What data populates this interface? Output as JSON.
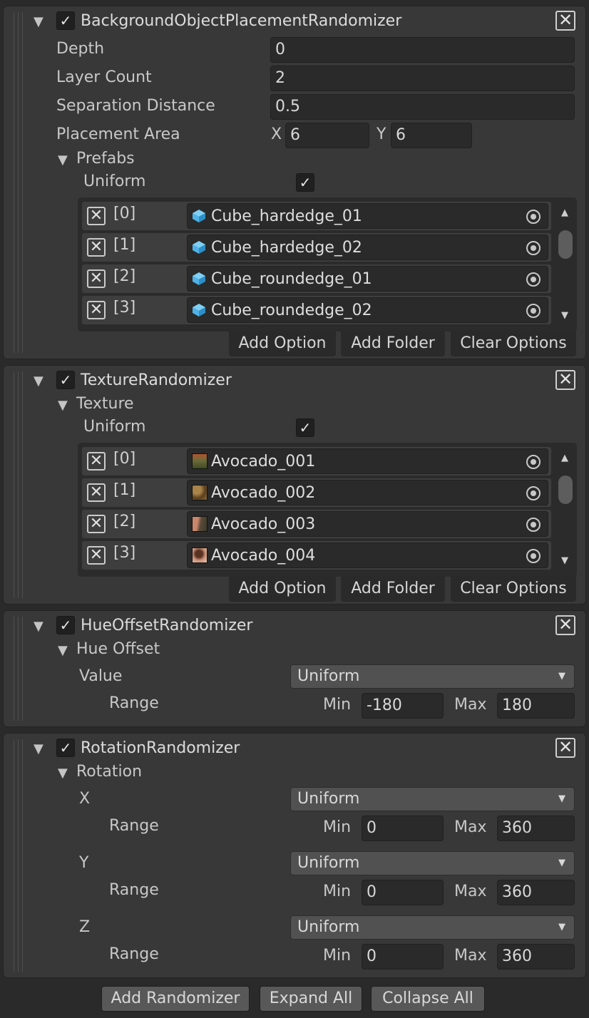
{
  "background_randomizer": {
    "title": "BackgroundObjectPlacementRandomizer",
    "enabled": "✓",
    "depth_label": "Depth",
    "depth_value": "0",
    "layer_count_label": "Layer Count",
    "layer_count_value": "2",
    "separation_label": "Separation Distance",
    "separation_value": "0.5",
    "placement_label": "Placement Area",
    "placement_x_label": "X",
    "placement_x_value": "6",
    "placement_y_label": "Y",
    "placement_y_value": "6",
    "prefabs_label": "Prefabs",
    "uniform_label": "Uniform",
    "uniform_check": "✓",
    "items": [
      {
        "index": "[0]",
        "name": "Cube_hardedge_01"
      },
      {
        "index": "[1]",
        "name": "Cube_hardedge_02"
      },
      {
        "index": "[2]",
        "name": "Cube_roundedge_01"
      },
      {
        "index": "[3]",
        "name": "Cube_roundedge_02"
      }
    ],
    "add_option": "Add Option",
    "add_folder": "Add Folder",
    "clear_options": "Clear Options"
  },
  "texture_randomizer": {
    "title": "TextureRandomizer",
    "enabled": "✓",
    "texture_label": "Texture",
    "uniform_label": "Uniform",
    "uniform_check": "✓",
    "items": [
      {
        "index": "[0]",
        "name": "Avocado_001"
      },
      {
        "index": "[1]",
        "name": "Avocado_002"
      },
      {
        "index": "[2]",
        "name": "Avocado_003"
      },
      {
        "index": "[3]",
        "name": "Avocado_004"
      }
    ],
    "add_option": "Add Option",
    "add_folder": "Add Folder",
    "clear_options": "Clear Options"
  },
  "hue_randomizer": {
    "title": "HueOffsetRandomizer",
    "enabled": "✓",
    "hue_label": "Hue Offset",
    "value_label": "Value",
    "value_dropdown": "Uniform",
    "range_label": "Range",
    "min_label": "Min",
    "min_value": "-180",
    "max_label": "Max",
    "max_value": "180"
  },
  "rotation_randomizer": {
    "title": "RotationRandomizer",
    "enabled": "✓",
    "rotation_label": "Rotation",
    "axes": [
      {
        "label": "X",
        "dropdown": "Uniform",
        "range_label": "Range",
        "min_label": "Min",
        "min_value": "0",
        "max_label": "Max",
        "max_value": "360"
      },
      {
        "label": "Y",
        "dropdown": "Uniform",
        "range_label": "Range",
        "min_label": "Min",
        "min_value": "0",
        "max_label": "Max",
        "max_value": "360"
      },
      {
        "label": "Z",
        "dropdown": "Uniform",
        "range_label": "Range",
        "min_label": "Min",
        "min_value": "0",
        "max_label": "Max",
        "max_value": "360"
      }
    ]
  },
  "bottom_bar": {
    "add_randomizer": "Add Randomizer",
    "expand_all": "Expand All",
    "collapse_all": "Collapse All"
  },
  "icons": {
    "foldout": "▼",
    "close": "✕",
    "scroll_up": "▲",
    "scroll_down": "▼",
    "dropdown": "▼"
  },
  "colors": {
    "panel_bg": "#383838",
    "page_bg": "#2a2a2a",
    "field_bg": "#2a2a2a",
    "cube_icon": "#4fb3e8"
  }
}
